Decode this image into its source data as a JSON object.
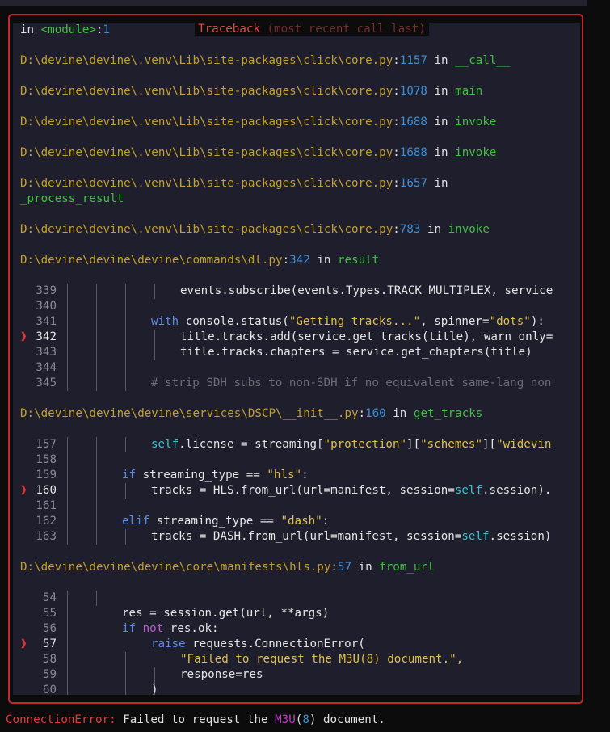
{
  "window": {
    "title_main": "Traceback",
    "title_sub": "(most recent call last)"
  },
  "frames": [
    {
      "path": "in <module>",
      "line": "1",
      "in_word": "",
      "func": ""
    },
    {
      "path": "D:\\devine\\devine\\.venv\\Lib\\site-packages\\click\\core.py",
      "line": "1157",
      "in_word": "in",
      "func": "__call__"
    },
    {
      "path": "D:\\devine\\devine\\.venv\\Lib\\site-packages\\click\\core.py",
      "line": "1078",
      "in_word": "in",
      "func": "main"
    },
    {
      "path": "D:\\devine\\devine\\.venv\\Lib\\site-packages\\click\\core.py",
      "line": "1688",
      "in_word": "in",
      "func": "invoke"
    },
    {
      "path": "D:\\devine\\devine\\.venv\\Lib\\site-packages\\click\\core.py",
      "line": "1688",
      "in_word": "in",
      "func": "invoke"
    },
    {
      "path": "D:\\devine\\devine\\.venv\\Lib\\site-packages\\click\\core.py",
      "line": "1657",
      "in_word": "in",
      "func": "_process_result"
    },
    {
      "path": "D:\\devine\\devine\\.venv\\Lib\\site-packages\\click\\core.py",
      "line": "783",
      "in_word": "in",
      "func": "invoke"
    },
    {
      "path": "D:\\devine\\devine\\devine\\commands\\dl.py",
      "line": "342",
      "in_word": "in",
      "func": "result"
    },
    {
      "path": "D:\\devine\\devine\\devine\\services\\DSCP\\__init__.py",
      "line": "160",
      "in_word": "in",
      "func": "get_tracks"
    },
    {
      "path": "D:\\devine\\devine\\devine\\core\\manifests\\hls.py",
      "line": "57",
      "in_word": "in",
      "func": "from_url"
    }
  ],
  "code_blocks": [
    {
      "lines": [
        {
          "n": "339",
          "cur": false,
          "text": "events.subscribe(events.Types.TRACK_MULTIPLEX, service"
        },
        {
          "n": "340",
          "cur": false,
          "text": ""
        },
        {
          "n": "341",
          "cur": false,
          "text": "with console.status(\"Getting tracks...\", spinner=\"dots\"):"
        },
        {
          "n": "342",
          "cur": true,
          "text": "title.tracks.add(service.get_tracks(title), warn_only="
        },
        {
          "n": "343",
          "cur": false,
          "text": "title.tracks.chapters = service.get_chapters(title)"
        },
        {
          "n": "344",
          "cur": false,
          "text": ""
        },
        {
          "n": "345",
          "cur": false,
          "text": "# strip SDH subs to non-SDH if no equivalent same-lang non"
        }
      ]
    },
    {
      "lines": [
        {
          "n": "157",
          "cur": false,
          "text": "self.license = streaming[\"protection\"][\"schemes\"][\"widevin"
        },
        {
          "n": "158",
          "cur": false,
          "text": ""
        },
        {
          "n": "159",
          "cur": false,
          "text": "if streaming_type == \"hls\":"
        },
        {
          "n": "160",
          "cur": true,
          "text": "tracks = HLS.from_url(url=manifest, session=self.session)."
        },
        {
          "n": "161",
          "cur": false,
          "text": ""
        },
        {
          "n": "162",
          "cur": false,
          "text": "elif streaming_type == \"dash\":"
        },
        {
          "n": "163",
          "cur": false,
          "text": "tracks = DASH.from_url(url=manifest, session=self.session)"
        }
      ]
    },
    {
      "lines": [
        {
          "n": "54",
          "cur": false,
          "text": ""
        },
        {
          "n": "55",
          "cur": false,
          "text": "res = session.get(url, **args)"
        },
        {
          "n": "56",
          "cur": false,
          "text": "if not res.ok:"
        },
        {
          "n": "57",
          "cur": true,
          "text": "raise requests.ConnectionError("
        },
        {
          "n": "58",
          "cur": false,
          "text": "\"Failed to request the M3U(8) document.\","
        },
        {
          "n": "59",
          "cur": false,
          "text": "response=res"
        },
        {
          "n": "60",
          "cur": false,
          "text": ")"
        }
      ]
    }
  ],
  "current_marker": "❱",
  "error": {
    "type": "ConnectionError:",
    "message_pre": " Failed to request the ",
    "highlight": "M3U",
    "paren_open": "(",
    "number": "8",
    "paren_close": ")",
    "message_post": " document."
  },
  "colors": {
    "border": "#c4262e",
    "path": "#c4a02c",
    "line_number": "#3d8fd6",
    "function": "#40c040",
    "error_type": "#e23a3a",
    "panel_bg": "#1e1e2c"
  }
}
